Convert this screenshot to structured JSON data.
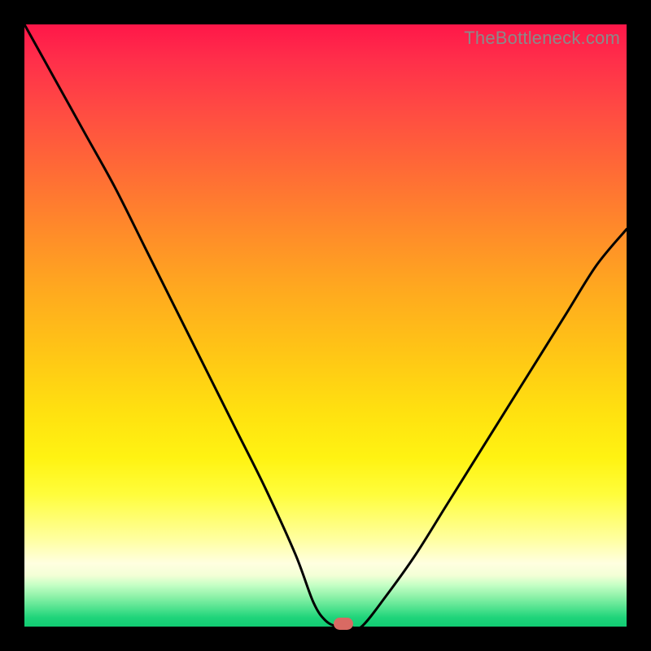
{
  "watermark": "TheBottleneck.com",
  "colors": {
    "frame": "#000000",
    "curve": "#000000",
    "marker": "#d96a63",
    "gradient_stops": [
      "#ff1749",
      "#ff8a2a",
      "#ffe010",
      "#ffffe0",
      "#11cc73"
    ]
  },
  "chart_data": {
    "type": "line",
    "title": "",
    "xlabel": "",
    "ylabel": "",
    "xlim": [
      0,
      100
    ],
    "ylim": [
      0,
      100
    ],
    "grid": false,
    "legend_position": "none",
    "series": [
      {
        "name": "bottleneck-curve",
        "x": [
          0,
          5,
          10,
          15,
          20,
          25,
          30,
          35,
          40,
          45,
          48,
          50,
          52,
          54,
          56,
          60,
          65,
          70,
          75,
          80,
          85,
          90,
          95,
          100
        ],
        "y": [
          100,
          91,
          82,
          73,
          63,
          53,
          43,
          33,
          23,
          12,
          4,
          1,
          0,
          0,
          0,
          5,
          12,
          20,
          28,
          36,
          44,
          52,
          60,
          66
        ]
      }
    ],
    "annotations": [
      {
        "name": "optimal-marker",
        "x": 53,
        "y": 0
      }
    ]
  }
}
